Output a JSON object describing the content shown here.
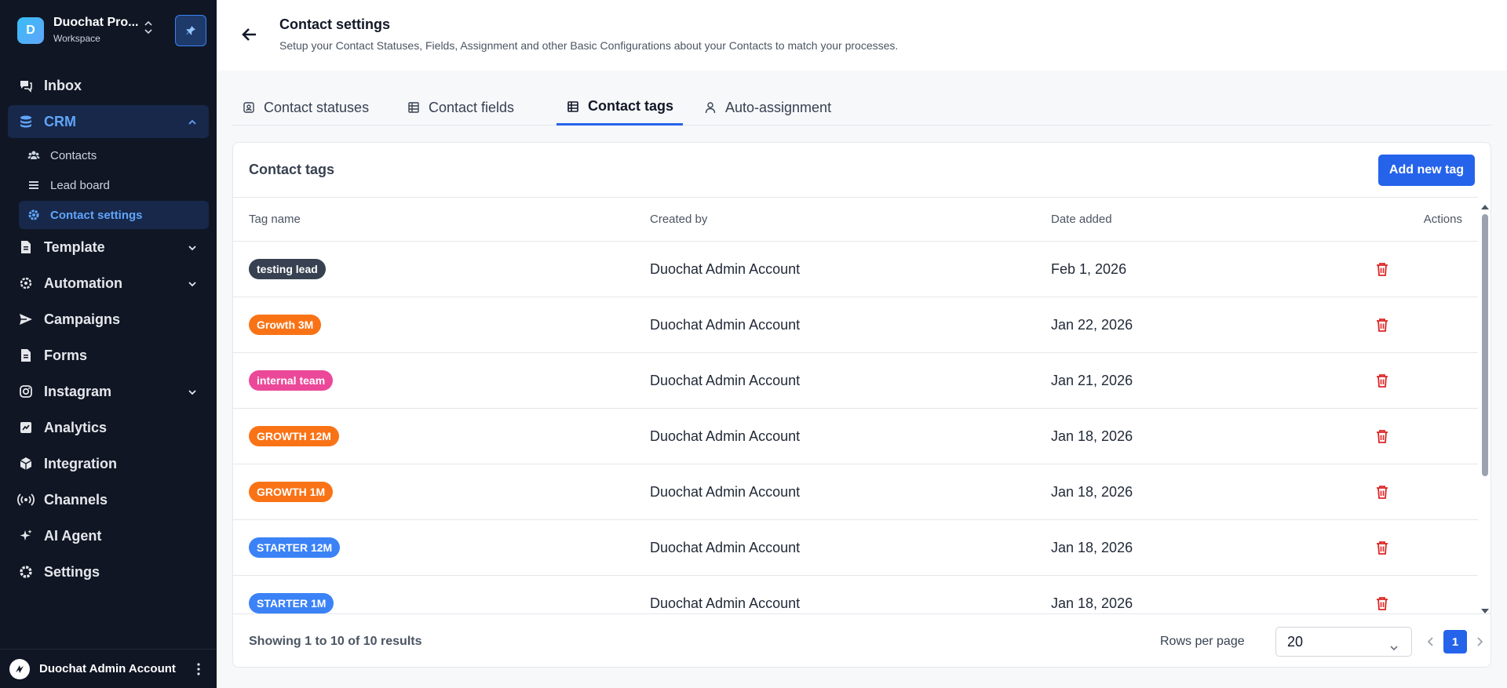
{
  "workspace": {
    "initial": "D",
    "name": "Duochat Pro...",
    "subtitle": "Workspace"
  },
  "nav": {
    "inbox": "Inbox",
    "crm": "CRM",
    "crm_sub": {
      "contacts": "Contacts",
      "lead_board": "Lead board",
      "contact_settings": "Contact settings"
    },
    "template": "Template",
    "automation": "Automation",
    "campaigns": "Campaigns",
    "forms": "Forms",
    "instagram": "Instagram",
    "analytics": "Analytics",
    "integration": "Integration",
    "channels": "Channels",
    "ai_agent": "AI Agent",
    "settings": "Settings"
  },
  "user": {
    "name": "Duochat Admin Account"
  },
  "header": {
    "title": "Contact settings",
    "subtitle": "Setup your Contact Statuses, Fields, Assignment and other Basic Configurations about your Contacts to match your processes."
  },
  "tabs": {
    "statuses": "Contact statuses",
    "fields": "Contact fields",
    "tags": "Contact tags",
    "assignment": "Auto-assignment"
  },
  "card": {
    "title": "Contact tags",
    "add_label": "Add new tag",
    "columns": {
      "tag": "Tag name",
      "created_by": "Created by",
      "date": "Date added",
      "actions": "Actions"
    },
    "rows": [
      {
        "tag": "testing lead",
        "color": "#374151",
        "created_by": "Duochat Admin Account",
        "date": "Feb 1, 2026"
      },
      {
        "tag": "Growth 3M",
        "color": "#f97316",
        "created_by": "Duochat Admin Account",
        "date": "Jan 22, 2026"
      },
      {
        "tag": "internal team",
        "color": "#ec4899",
        "created_by": "Duochat Admin Account",
        "date": "Jan 21, 2026"
      },
      {
        "tag": "GROWTH 12M",
        "color": "#f97316",
        "created_by": "Duochat Admin Account",
        "date": "Jan 18, 2026"
      },
      {
        "tag": "GROWTH 1M",
        "color": "#f97316",
        "created_by": "Duochat Admin Account",
        "date": "Jan 18, 2026"
      },
      {
        "tag": "STARTER 12M",
        "color": "#3b82f6",
        "created_by": "Duochat Admin Account",
        "date": "Jan 18, 2026"
      },
      {
        "tag": "STARTER 1M",
        "color": "#3b82f6",
        "created_by": "Duochat Admin Account",
        "date": "Jan 18, 2026"
      }
    ]
  },
  "footer": {
    "showing": "Showing 1 to 10 of 10 results",
    "rows_per_page_label": "Rows per page",
    "rows_per_page_value": "20",
    "current_page": "1"
  },
  "colors": {
    "accent": "#2563eb",
    "sidebar": "#101624",
    "danger": "#dc2626"
  }
}
